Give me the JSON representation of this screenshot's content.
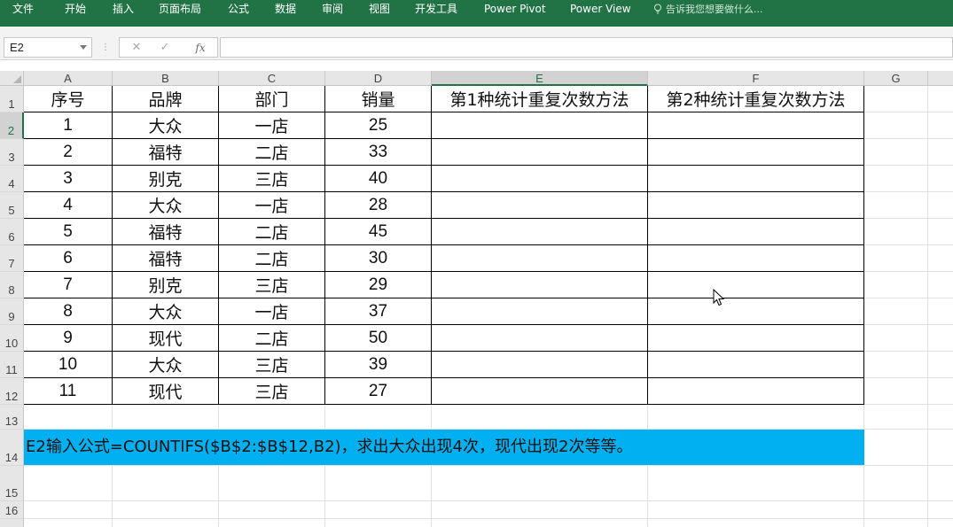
{
  "ribbon": {
    "tabs": [
      "文件",
      "开始",
      "插入",
      "页面布局",
      "公式",
      "数据",
      "审阅",
      "视图",
      "开发工具",
      "Power Pivot",
      "Power View"
    ],
    "tell_me": "告诉我您想要做什么..."
  },
  "formula_bar": {
    "name_box": "E2",
    "cancel_symbol": "✕",
    "enter_symbol": "✓",
    "fx_symbol": "fx",
    "formula": ""
  },
  "columns": [
    "A",
    "B",
    "C",
    "D",
    "E",
    "F",
    "G"
  ],
  "selected_column": "E",
  "rows": [
    "1",
    "2",
    "3",
    "4",
    "5",
    "6",
    "7",
    "8",
    "9",
    "10",
    "11",
    "12",
    "13",
    "14",
    "15",
    "16"
  ],
  "selected_row": "2",
  "table": {
    "headers": [
      "序号",
      "品牌",
      "部门",
      "销量",
      "第1种统计重复次数方法",
      "第2种统计重复次数方法"
    ],
    "rows": [
      [
        "1",
        "大众",
        "一店",
        "25",
        "",
        ""
      ],
      [
        "2",
        "福特",
        "二店",
        "33",
        "",
        ""
      ],
      [
        "3",
        "别克",
        "三店",
        "40",
        "",
        ""
      ],
      [
        "4",
        "大众",
        "一店",
        "28",
        "",
        ""
      ],
      [
        "5",
        "福特",
        "二店",
        "45",
        "",
        ""
      ],
      [
        "6",
        "福特",
        "二店",
        "30",
        "",
        ""
      ],
      [
        "7",
        "别克",
        "三店",
        "29",
        "",
        ""
      ],
      [
        "8",
        "大众",
        "一店",
        "37",
        "",
        ""
      ],
      [
        "9",
        "现代",
        "二店",
        "50",
        "",
        ""
      ],
      [
        "10",
        "大众",
        "三店",
        "39",
        "",
        ""
      ],
      [
        "11",
        "现代",
        "三店",
        "27",
        "",
        ""
      ]
    ]
  },
  "note": {
    "text": "E2输入公式=COUNTIFS($B$2:$B$12,B2)，求出大众出现4次，现代出现2次等等。",
    "background": "#00b0f0"
  },
  "colors": {
    "ribbon": "#217346",
    "accent": "#217346"
  }
}
